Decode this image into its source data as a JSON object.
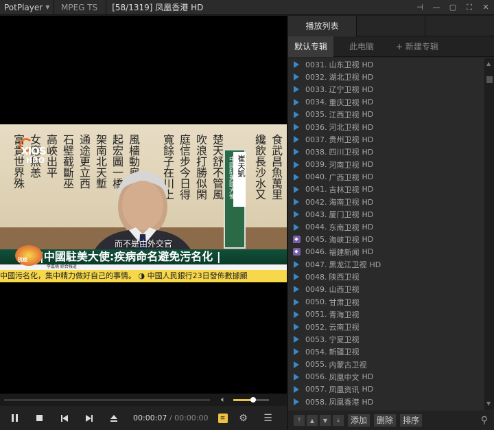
{
  "titlebar": {
    "app_name": "PotPlayer",
    "codec": "MPEG TS",
    "title": "[58/1319] 凤凰香港 HD"
  },
  "video": {
    "logo_top": "XIOS",
    "logo_bottom": "HBO",
    "nameplate_title": "中國駐美國大使",
    "nameplate_name": "崔天凱",
    "subtitle": "而不是由外交官",
    "headline": "|中國駐美大使:疾病命名避免污名化  |",
    "meta_line": "李嘉楠  綜合報道",
    "badge_text": "抗疫",
    "ticker": "中國污名化，集中精力做好自己的事情。  ◑ 中國人民銀行23日發佈數據顯"
  },
  "playback": {
    "current_time": "00:00:07",
    "separator": " / ",
    "total_time": "00:00:00",
    "volume_level": 0.55
  },
  "playlist": {
    "tab_main": "播放列表",
    "subtabs": [
      "默认专辑",
      "此电脑",
      "+ 新建专辑"
    ],
    "items": [
      {
        "num": "0031.",
        "name": "山东卫视",
        "hd": "HD",
        "icon": "play"
      },
      {
        "num": "0032.",
        "name": "湖北卫视",
        "hd": "HD",
        "icon": "play"
      },
      {
        "num": "0033.",
        "name": "辽宁卫视",
        "hd": "HD",
        "icon": "play"
      },
      {
        "num": "0034.",
        "name": "重庆卫视",
        "hd": "HD",
        "icon": "play"
      },
      {
        "num": "0035.",
        "name": "江西卫视",
        "hd": "HD",
        "icon": "play"
      },
      {
        "num": "0036.",
        "name": "河北卫视",
        "hd": "HD",
        "icon": "play"
      },
      {
        "num": "0037.",
        "name": "贵州卫视",
        "hd": "HD",
        "icon": "play"
      },
      {
        "num": "0038.",
        "name": "四川卫视",
        "hd": "HD",
        "icon": "play"
      },
      {
        "num": "0039.",
        "name": "河南卫视",
        "hd": "HD",
        "icon": "play"
      },
      {
        "num": "0040.",
        "name": "广西卫视",
        "hd": "HD",
        "icon": "play"
      },
      {
        "num": "0041.",
        "name": "吉林卫视",
        "hd": "HD",
        "icon": "play"
      },
      {
        "num": "0042.",
        "name": "海南卫视",
        "hd": "HD",
        "icon": "play"
      },
      {
        "num": "0043.",
        "name": "厦门卫视",
        "hd": "HD",
        "icon": "play"
      },
      {
        "num": "0044.",
        "name": "东南卫视",
        "hd": "HD",
        "icon": "play"
      },
      {
        "num": "0045.",
        "name": "海峡卫视",
        "hd": "HD",
        "icon": "box"
      },
      {
        "num": "0046.",
        "name": "福建新闻",
        "hd": "HD",
        "icon": "box"
      },
      {
        "num": "0047.",
        "name": "黑龙江卫视",
        "hd": "HD",
        "icon": "play"
      },
      {
        "num": "0048.",
        "name": "陕西卫视",
        "hd": "",
        "icon": "play"
      },
      {
        "num": "0049.",
        "name": "山西卫视",
        "hd": "",
        "icon": "play"
      },
      {
        "num": "0050.",
        "name": "甘肃卫视",
        "hd": "",
        "icon": "play"
      },
      {
        "num": "0051.",
        "name": "青海卫视",
        "hd": "",
        "icon": "play"
      },
      {
        "num": "0052.",
        "name": "云南卫视",
        "hd": "",
        "icon": "play"
      },
      {
        "num": "0053.",
        "name": "宁夏卫视",
        "hd": "",
        "icon": "play"
      },
      {
        "num": "0054.",
        "name": "新疆卫视",
        "hd": "",
        "icon": "play"
      },
      {
        "num": "0055.",
        "name": "内蒙古卫视",
        "hd": "",
        "icon": "play"
      },
      {
        "num": "0056.",
        "name": "凤凰中文",
        "hd": "HD",
        "icon": "play"
      },
      {
        "num": "0057.",
        "name": "凤凰资讯",
        "hd": "HD",
        "icon": "play"
      },
      {
        "num": "0058.",
        "name": "凤凰香港",
        "hd": "HD",
        "icon": "play"
      }
    ],
    "buttons": {
      "add": "添加",
      "delete": "删除",
      "sort": "排序"
    }
  },
  "colors": {
    "accent": "#f0c040",
    "play_icon": "#3a88c8",
    "box_icon": "#7a5ea8"
  }
}
